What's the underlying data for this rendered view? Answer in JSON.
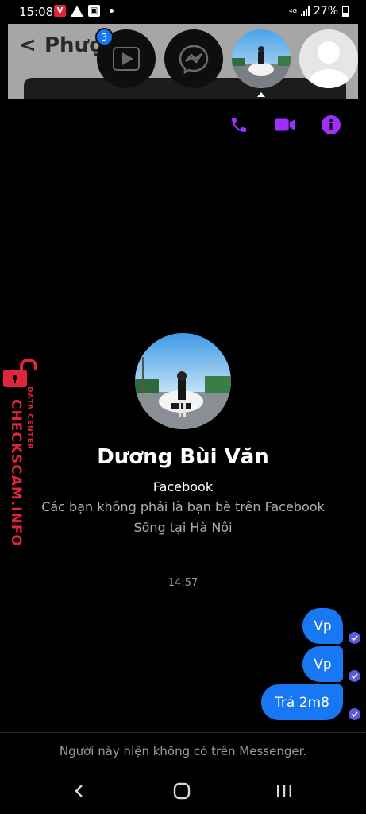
{
  "status_bar": {
    "time": "15:08",
    "network_label": "4G",
    "battery": "27%"
  },
  "overlay": {
    "faded_back": "<",
    "faded_contact_name": "Phượ    hi",
    "badge_count": "3",
    "icons": [
      "video-play-icon",
      "messenger-icon",
      "contact-photo-bubble",
      "default-avatar-icon"
    ]
  },
  "actions": {
    "icons": [
      "phone-icon",
      "video-camera-icon",
      "info-icon"
    ],
    "accent_color": "#9b30ff"
  },
  "profile": {
    "name": "Dương Bùi Văn",
    "source": "Facebook",
    "line1": "Các bạn không phải là bạn bè trên Facebook",
    "line2": "Sống tại Hà Nội"
  },
  "conversation": {
    "timestamp": "14:57",
    "messages": [
      {
        "text": "Vp",
        "sender": "me"
      },
      {
        "text": "Vp",
        "sender": "me"
      },
      {
        "text": "Trả 2m8",
        "sender": "me"
      }
    ],
    "bubble_color": "#1877f2"
  },
  "footer": {
    "unavailable_text": "Người này hiện không có trên Messenger."
  },
  "navbar": {
    "icons": [
      "back-icon",
      "home-icon",
      "recent-apps-icon"
    ]
  },
  "watermark": {
    "main": "CHECKSCAM.INFO",
    "sub": "DATA CENTER"
  }
}
